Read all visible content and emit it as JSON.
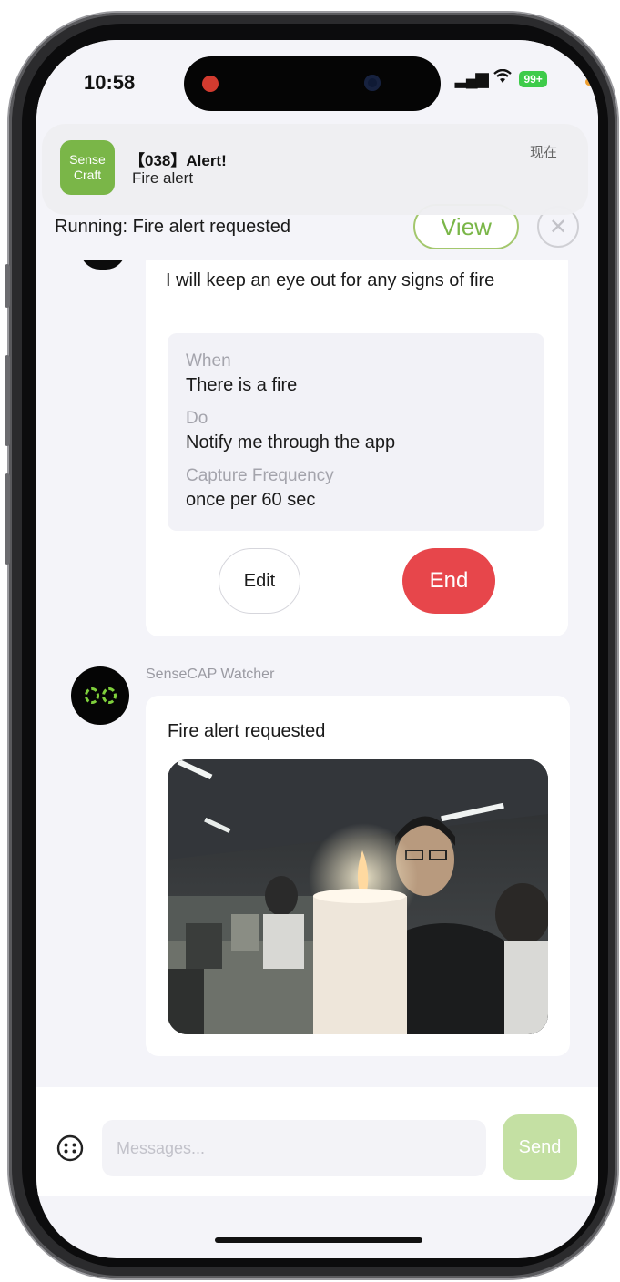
{
  "status_bar": {
    "time": "10:58",
    "battery": "99+"
  },
  "notification": {
    "app_icon_line1": "Sense",
    "app_icon_line2": "Craft",
    "title": "【038】Alert!",
    "body": "Fire alert",
    "time": "现在"
  },
  "running_bar": {
    "text": "Running: Fire alert requested",
    "view_label": "View",
    "close_label": "✕"
  },
  "task_card": {
    "intro": "I will keep an eye out for any signs of fire",
    "when_label": "When",
    "when_value": "There is a fire",
    "do_label": "Do",
    "do_value": "Notify me through the app",
    "frequency_label": "Capture Frequency",
    "frequency_value": "once per 60 sec",
    "edit_label": "Edit",
    "end_label": "End"
  },
  "message": {
    "sender": "SenseCAP Watcher",
    "text": "Fire alert requested"
  },
  "composer": {
    "placeholder": "Messages...",
    "send_label": "Send"
  },
  "colors": {
    "brand_green": "#7ab648",
    "end_red": "#e7464b",
    "send_disabled": "#c4e0a3"
  }
}
